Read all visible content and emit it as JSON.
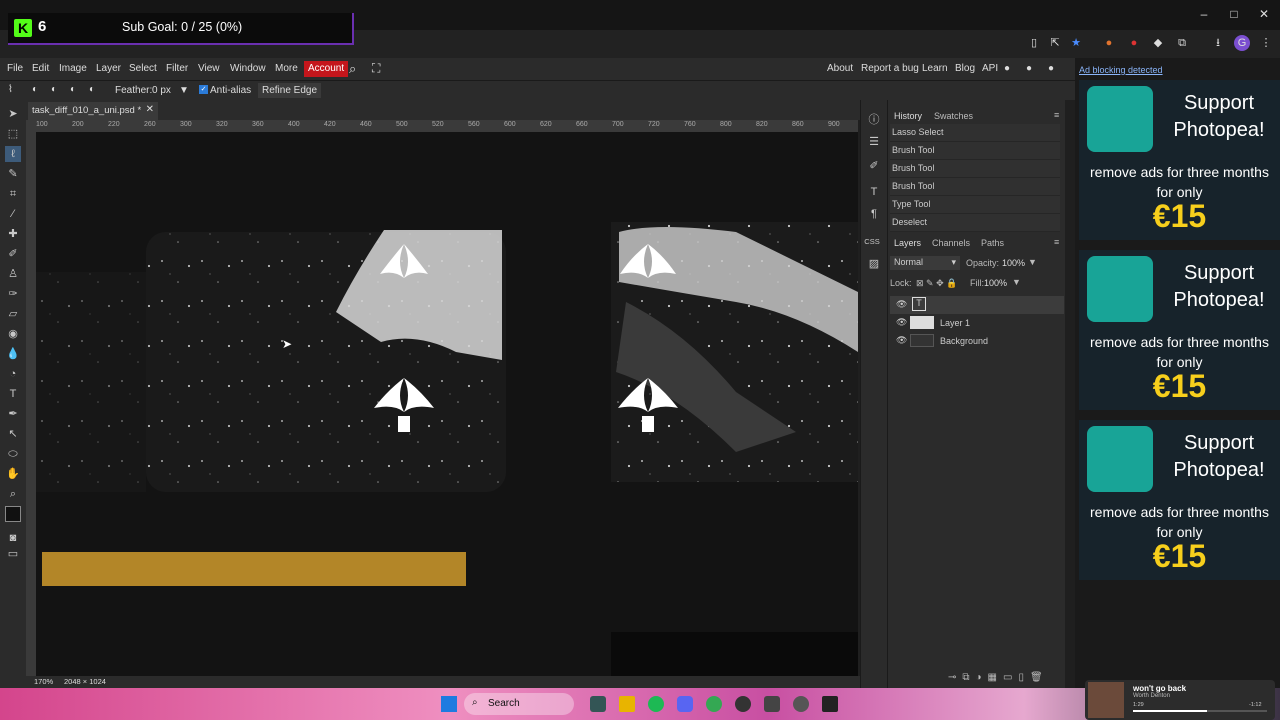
{
  "overlay": {
    "counter": "6",
    "goal": "Sub Goal: 0 / 25 (0%)"
  },
  "menubar": {
    "items": [
      "File",
      "Edit",
      "Image",
      "Layer",
      "Select",
      "Filter",
      "View",
      "Window",
      "More"
    ],
    "account": "Account",
    "right_links": [
      "About",
      "Report a bug",
      "Learn",
      "Blog",
      "API"
    ]
  },
  "options": {
    "feather_label": "Feather:",
    "feather_value": "0 px",
    "antialias": "Anti-alias",
    "refine": "Refine Edge"
  },
  "document": {
    "tab": "task_diff_010_a_uni.psd *",
    "zoom": "170%",
    "size": "2048 × 1024"
  },
  "ruler_ticks": [
    "100",
    "200",
    "220",
    "260",
    "300",
    "320",
    "360",
    "400",
    "420",
    "460",
    "500",
    "520",
    "560",
    "600",
    "620",
    "660",
    "700",
    "720",
    "760",
    "800",
    "820",
    "860",
    "900"
  ],
  "history": {
    "tabs": [
      "History",
      "Swatches"
    ],
    "items": [
      "Lasso Select",
      "Brush Tool",
      "Brush Tool",
      "Brush Tool",
      "Type Tool",
      "Deselect"
    ]
  },
  "layers": {
    "tabs": [
      "Layers",
      "Channels",
      "Paths"
    ],
    "blend": "Normal",
    "opacity_label": "Opacity:",
    "opacity_value": "100%",
    "lock_label": "Lock:",
    "fill_label": "Fill:",
    "fill_value": "100%",
    "items": [
      "",
      "Layer 1",
      "Background"
    ]
  },
  "ads": {
    "notice": "Ad blocking detected",
    "units": [
      {
        "title": "Support Photopea!",
        "body": "remove ads for three months for only",
        "price": "€15"
      },
      {
        "title": "Support Photopea!",
        "body": "remove ads for three months for only",
        "price": "€15"
      },
      {
        "title": "Support Photopea!",
        "body": "remove ads for three months for only",
        "price": "€15"
      }
    ]
  },
  "taskbar": {
    "search": "Search"
  },
  "media": {
    "title": "won't go back",
    "artist": "Worth Denton",
    "elapsed": "1:29",
    "remaining": "-1:12"
  },
  "colors": {
    "accent": "#c4161c",
    "ad_brand": "#18a497",
    "price": "#f7cf1c",
    "bar": "#b38628"
  }
}
